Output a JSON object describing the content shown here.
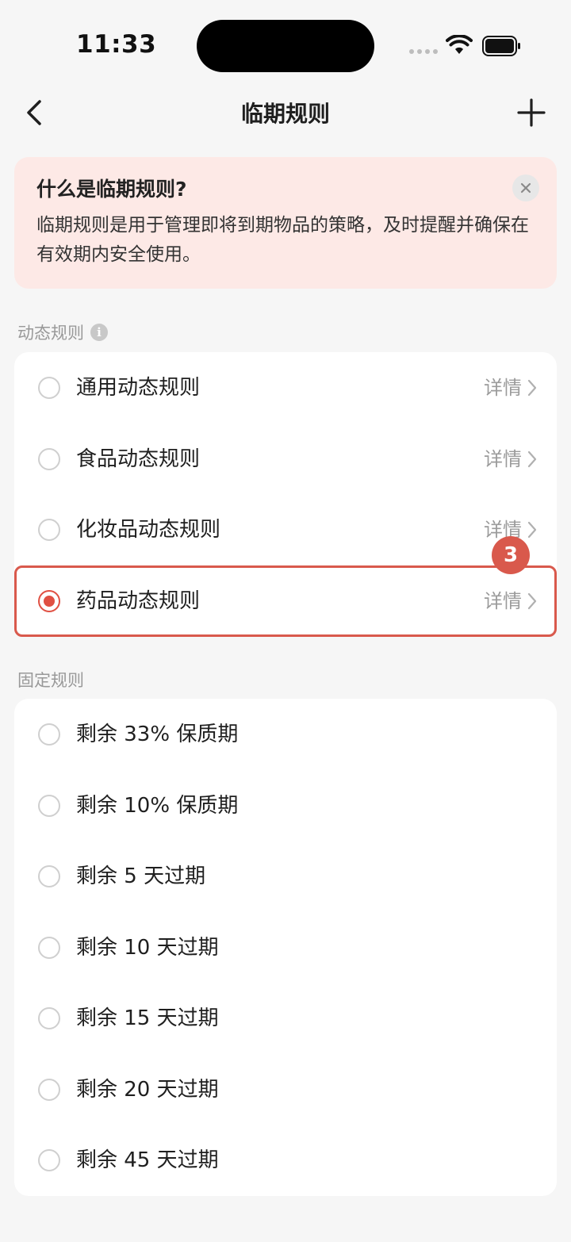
{
  "status_bar": {
    "time": "11:33"
  },
  "nav": {
    "title": "临期规则"
  },
  "info_banner": {
    "title": "什么是临期规则?",
    "body": "临期规则是用于管理即将到期物品的策略，及时提醒并确保在有效期内安全使用。"
  },
  "dynamic_section": {
    "header": "动态规则",
    "info_glyph": "i",
    "items": [
      {
        "label": "通用动态规则",
        "detail": "详情",
        "selected": false
      },
      {
        "label": "食品动态规则",
        "detail": "详情",
        "selected": false
      },
      {
        "label": "化妆品动态规则",
        "detail": "详情",
        "selected": false
      },
      {
        "label": "药品动态规则",
        "detail": "详情",
        "selected": true
      }
    ]
  },
  "fixed_section": {
    "header": "固定规则",
    "items": [
      {
        "label": "剩余 33% 保质期",
        "selected": false
      },
      {
        "label": "剩余 10% 保质期",
        "selected": false
      },
      {
        "label": "剩余 5 天过期",
        "selected": false
      },
      {
        "label": "剩余 10 天过期",
        "selected": false
      },
      {
        "label": "剩余 15 天过期",
        "selected": false
      },
      {
        "label": "剩余 20 天过期",
        "selected": false
      },
      {
        "label": "剩余 45 天过期",
        "selected": false
      }
    ]
  },
  "annotation": {
    "step_number": "3"
  },
  "colors": {
    "accent": "#e05043",
    "banner_bg": "#fde9e6",
    "page_bg": "#f6f6f6"
  }
}
